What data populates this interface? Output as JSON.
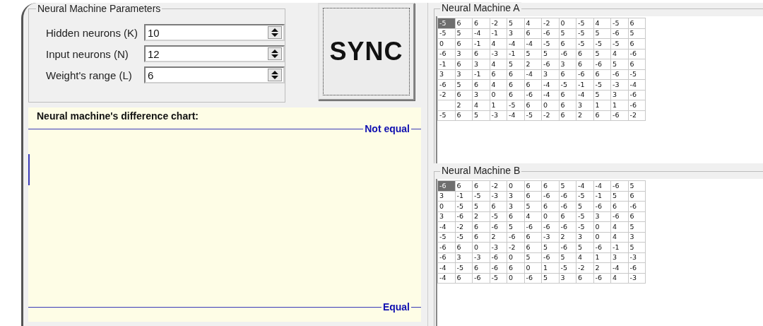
{
  "parameters": {
    "title": "Neural Machine Parameters",
    "fields": [
      {
        "label": "Hidden neurons (K)",
        "value": "10"
      },
      {
        "label": "Input neurons (N)",
        "value": "12"
      },
      {
        "label": "Weight's range (L)",
        "value": "6"
      }
    ]
  },
  "sync_button": {
    "label": "SYNC"
  },
  "chart": {
    "title": "Neural machine's difference chart:",
    "top_label": "Not equal",
    "bottom_label": "Equal"
  },
  "machines": [
    {
      "title": "Neural Machine A",
      "rows": [
        [
          {
            "text": "-5",
            "selected": true
          },
          {
            "text": "6",
            "selected": false
          },
          {
            "text": "6",
            "selected": false
          },
          {
            "text": "-2",
            "selected": false
          },
          {
            "text": "5",
            "selected": false
          },
          {
            "text": "4",
            "selected": false
          },
          {
            "text": "-2",
            "selected": false
          },
          {
            "text": "0",
            "selected": false
          },
          {
            "text": "-5",
            "selected": false
          },
          {
            "text": "4",
            "selected": false
          },
          {
            "text": "-5",
            "selected": false
          },
          {
            "text": "6",
            "selected": false
          }
        ],
        [
          {
            "text": "-5",
            "selected": false
          },
          {
            "text": "5",
            "selected": false
          },
          {
            "text": "-4",
            "selected": false
          },
          {
            "text": "-1",
            "selected": false
          },
          {
            "text": "3",
            "selected": false
          },
          {
            "text": "6",
            "selected": false
          },
          {
            "text": "-6",
            "selected": false
          },
          {
            "text": "5",
            "selected": false
          },
          {
            "text": "-5",
            "selected": false
          },
          {
            "text": "5",
            "selected": false
          },
          {
            "text": "-6",
            "selected": false
          },
          {
            "text": "5",
            "selected": false
          }
        ],
        [
          {
            "text": "0",
            "selected": false
          },
          {
            "text": "6",
            "selected": false
          },
          {
            "text": "-1",
            "selected": false
          },
          {
            "text": "4",
            "selected": false
          },
          {
            "text": "-4",
            "selected": false
          },
          {
            "text": "-4",
            "selected": false
          },
          {
            "text": "-5",
            "selected": false
          },
          {
            "text": "6",
            "selected": false
          },
          {
            "text": "-5",
            "selected": false
          },
          {
            "text": "-5",
            "selected": false
          },
          {
            "text": "-5",
            "selected": false
          },
          {
            "text": "6",
            "selected": false
          }
        ],
        [
          {
            "text": "-6",
            "selected": false
          },
          {
            "text": "3",
            "selected": false
          },
          {
            "text": "6",
            "selected": false
          },
          {
            "text": "-3",
            "selected": false
          },
          {
            "text": "-1",
            "selected": false
          },
          {
            "text": "5",
            "selected": false
          },
          {
            "text": "5",
            "selected": false
          },
          {
            "text": "-6",
            "selected": false
          },
          {
            "text": "6",
            "selected": false
          },
          {
            "text": "5",
            "selected": false
          },
          {
            "text": "4",
            "selected": false
          },
          {
            "text": "-6",
            "selected": false
          }
        ],
        [
          {
            "text": "-1",
            "selected": false
          },
          {
            "text": "6",
            "selected": false
          },
          {
            "text": "3",
            "selected": false
          },
          {
            "text": "4",
            "selected": false
          },
          {
            "text": "5",
            "selected": false
          },
          {
            "text": "2",
            "selected": false
          },
          {
            "text": "-6",
            "selected": false
          },
          {
            "text": "3",
            "selected": false
          },
          {
            "text": "6",
            "selected": false
          },
          {
            "text": "-6",
            "selected": false
          },
          {
            "text": "5",
            "selected": false
          },
          {
            "text": "6",
            "selected": false
          }
        ],
        [
          {
            "text": "3",
            "selected": false
          },
          {
            "text": "3",
            "selected": false
          },
          {
            "text": "-1",
            "selected": false
          },
          {
            "text": "6",
            "selected": false
          },
          {
            "text": "6",
            "selected": false
          },
          {
            "text": "-4",
            "selected": false
          },
          {
            "text": "3",
            "selected": false
          },
          {
            "text": "6",
            "selected": false
          },
          {
            "text": "-6",
            "selected": false
          },
          {
            "text": "6",
            "selected": false
          },
          {
            "text": "-6",
            "selected": false
          },
          {
            "text": "-5",
            "selected": false
          }
        ],
        [
          {
            "text": "-6",
            "selected": false
          },
          {
            "text": "5",
            "selected": false
          },
          {
            "text": "6",
            "selected": false
          },
          {
            "text": "4",
            "selected": false
          },
          {
            "text": "6",
            "selected": false
          },
          {
            "text": "6",
            "selected": false
          },
          {
            "text": "-4",
            "selected": false
          },
          {
            "text": "-5",
            "selected": false
          },
          {
            "text": "-1",
            "selected": false
          },
          {
            "text": "-5",
            "selected": false
          },
          {
            "text": "-3",
            "selected": false
          },
          {
            "text": "-4",
            "selected": false
          }
        ],
        [
          {
            "text": "-2",
            "selected": false
          },
          {
            "text": "6",
            "selected": false
          },
          {
            "text": "3",
            "selected": false
          },
          {
            "text": "0",
            "selected": false
          },
          {
            "text": "6",
            "selected": false
          },
          {
            "text": "-6",
            "selected": false
          },
          {
            "text": "-4",
            "selected": false
          },
          {
            "text": "6",
            "selected": false
          },
          {
            "text": "-4",
            "selected": false
          },
          {
            "text": "5",
            "selected": false
          },
          {
            "text": "3",
            "selected": false
          },
          {
            "text": "-6",
            "selected": false
          }
        ],
        [
          {
            "text": "",
            "selected": false
          },
          {
            "text": "2",
            "selected": false
          },
          {
            "text": "4",
            "selected": false
          },
          {
            "text": "1",
            "selected": false
          },
          {
            "text": "-5",
            "selected": false
          },
          {
            "text": "6",
            "selected": false
          },
          {
            "text": "0",
            "selected": false
          },
          {
            "text": "6",
            "selected": false
          },
          {
            "text": "3",
            "selected": false
          },
          {
            "text": "1",
            "selected": false
          },
          {
            "text": "1",
            "selected": false
          },
          {
            "text": "-6",
            "selected": false
          }
        ],
        [
          {
            "text": "-5",
            "selected": false
          },
          {
            "text": "6",
            "selected": false
          },
          {
            "text": "5",
            "selected": false
          },
          {
            "text": "-3",
            "selected": false
          },
          {
            "text": "-4",
            "selected": false
          },
          {
            "text": "-5",
            "selected": false
          },
          {
            "text": "-2",
            "selected": false
          },
          {
            "text": "6",
            "selected": false
          },
          {
            "text": "2",
            "selected": false
          },
          {
            "text": "6",
            "selected": false
          },
          {
            "text": "-6",
            "selected": false
          },
          {
            "text": "-2",
            "selected": false
          }
        ]
      ]
    },
    {
      "title": "Neural Machine B",
      "rows": [
        [
          {
            "text": "-6",
            "selected": true
          },
          {
            "text": "6",
            "selected": false
          },
          {
            "text": "6",
            "selected": false
          },
          {
            "text": "-2",
            "selected": false
          },
          {
            "text": "0",
            "selected": false
          },
          {
            "text": "6",
            "selected": false
          },
          {
            "text": "6",
            "selected": false
          },
          {
            "text": "5",
            "selected": false
          },
          {
            "text": "-4",
            "selected": false
          },
          {
            "text": "-4",
            "selected": false
          },
          {
            "text": "-6",
            "selected": false
          },
          {
            "text": "5",
            "selected": false
          }
        ],
        [
          {
            "text": "3",
            "selected": false
          },
          {
            "text": "-1",
            "selected": false
          },
          {
            "text": "-5",
            "selected": false
          },
          {
            "text": "-3",
            "selected": false
          },
          {
            "text": "3",
            "selected": false
          },
          {
            "text": "6",
            "selected": false
          },
          {
            "text": "-6",
            "selected": false
          },
          {
            "text": "-6",
            "selected": false
          },
          {
            "text": "-5",
            "selected": false
          },
          {
            "text": "-1",
            "selected": false
          },
          {
            "text": "5",
            "selected": false
          },
          {
            "text": "6",
            "selected": false
          }
        ],
        [
          {
            "text": "0",
            "selected": false
          },
          {
            "text": "-5",
            "selected": false
          },
          {
            "text": "5",
            "selected": false
          },
          {
            "text": "6",
            "selected": false
          },
          {
            "text": "3",
            "selected": false
          },
          {
            "text": "5",
            "selected": false
          },
          {
            "text": "6",
            "selected": false
          },
          {
            "text": "-6",
            "selected": false
          },
          {
            "text": "5",
            "selected": false
          },
          {
            "text": "-6",
            "selected": false
          },
          {
            "text": "6",
            "selected": false
          },
          {
            "text": "-6",
            "selected": false
          }
        ],
        [
          {
            "text": "3",
            "selected": false
          },
          {
            "text": "-6",
            "selected": false
          },
          {
            "text": "2",
            "selected": false
          },
          {
            "text": "-5",
            "selected": false
          },
          {
            "text": "6",
            "selected": false
          },
          {
            "text": "4",
            "selected": false
          },
          {
            "text": "0",
            "selected": false
          },
          {
            "text": "6",
            "selected": false
          },
          {
            "text": "-5",
            "selected": false
          },
          {
            "text": "3",
            "selected": false
          },
          {
            "text": "-6",
            "selected": false
          },
          {
            "text": "6",
            "selected": false
          }
        ],
        [
          {
            "text": "-4",
            "selected": false
          },
          {
            "text": "-2",
            "selected": false
          },
          {
            "text": "6",
            "selected": false
          },
          {
            "text": "-6",
            "selected": false
          },
          {
            "text": "5",
            "selected": false
          },
          {
            "text": "-6",
            "selected": false
          },
          {
            "text": "-6",
            "selected": false
          },
          {
            "text": "-6",
            "selected": false
          },
          {
            "text": "-5",
            "selected": false
          },
          {
            "text": "0",
            "selected": false
          },
          {
            "text": "4",
            "selected": false
          },
          {
            "text": "5",
            "selected": false
          }
        ],
        [
          {
            "text": "-5",
            "selected": false
          },
          {
            "text": "-5",
            "selected": false
          },
          {
            "text": "6",
            "selected": false
          },
          {
            "text": "2",
            "selected": false
          },
          {
            "text": "-6",
            "selected": false
          },
          {
            "text": "6",
            "selected": false
          },
          {
            "text": "-3",
            "selected": false
          },
          {
            "text": "2",
            "selected": false
          },
          {
            "text": "3",
            "selected": false
          },
          {
            "text": "0",
            "selected": false
          },
          {
            "text": "4",
            "selected": false
          },
          {
            "text": "3",
            "selected": false
          }
        ],
        [
          {
            "text": "-6",
            "selected": false
          },
          {
            "text": "6",
            "selected": false
          },
          {
            "text": "0",
            "selected": false
          },
          {
            "text": "-3",
            "selected": false
          },
          {
            "text": "-2",
            "selected": false
          },
          {
            "text": "6",
            "selected": false
          },
          {
            "text": "5",
            "selected": false
          },
          {
            "text": "-6",
            "selected": false
          },
          {
            "text": "5",
            "selected": false
          },
          {
            "text": "-6",
            "selected": false
          },
          {
            "text": "-1",
            "selected": false
          },
          {
            "text": "5",
            "selected": false
          }
        ],
        [
          {
            "text": "-6",
            "selected": false
          },
          {
            "text": "3",
            "selected": false
          },
          {
            "text": "-3",
            "selected": false
          },
          {
            "text": "-6",
            "selected": false
          },
          {
            "text": "0",
            "selected": false
          },
          {
            "text": "5",
            "selected": false
          },
          {
            "text": "-6",
            "selected": false
          },
          {
            "text": "5",
            "selected": false
          },
          {
            "text": "4",
            "selected": false
          },
          {
            "text": "1",
            "selected": false
          },
          {
            "text": "3",
            "selected": false
          },
          {
            "text": "-3",
            "selected": false
          }
        ],
        [
          {
            "text": "-4",
            "selected": false
          },
          {
            "text": "-5",
            "selected": false
          },
          {
            "text": "6",
            "selected": false
          },
          {
            "text": "-6",
            "selected": false
          },
          {
            "text": "6",
            "selected": false
          },
          {
            "text": "0",
            "selected": false
          },
          {
            "text": "1",
            "selected": false
          },
          {
            "text": "-5",
            "selected": false
          },
          {
            "text": "-2",
            "selected": false
          },
          {
            "text": "2",
            "selected": false
          },
          {
            "text": "-4",
            "selected": false
          },
          {
            "text": "-6",
            "selected": false
          }
        ],
        [
          {
            "text": "-4",
            "selected": false
          },
          {
            "text": "6",
            "selected": false
          },
          {
            "text": "-6",
            "selected": false
          },
          {
            "text": "-5",
            "selected": false
          },
          {
            "text": "0",
            "selected": false
          },
          {
            "text": "-6",
            "selected": false
          },
          {
            "text": "5",
            "selected": false
          },
          {
            "text": "3",
            "selected": false
          },
          {
            "text": "6",
            "selected": false
          },
          {
            "text": "-6",
            "selected": false
          },
          {
            "text": "4",
            "selected": false
          },
          {
            "text": "-3",
            "selected": false
          }
        ]
      ]
    }
  ]
}
